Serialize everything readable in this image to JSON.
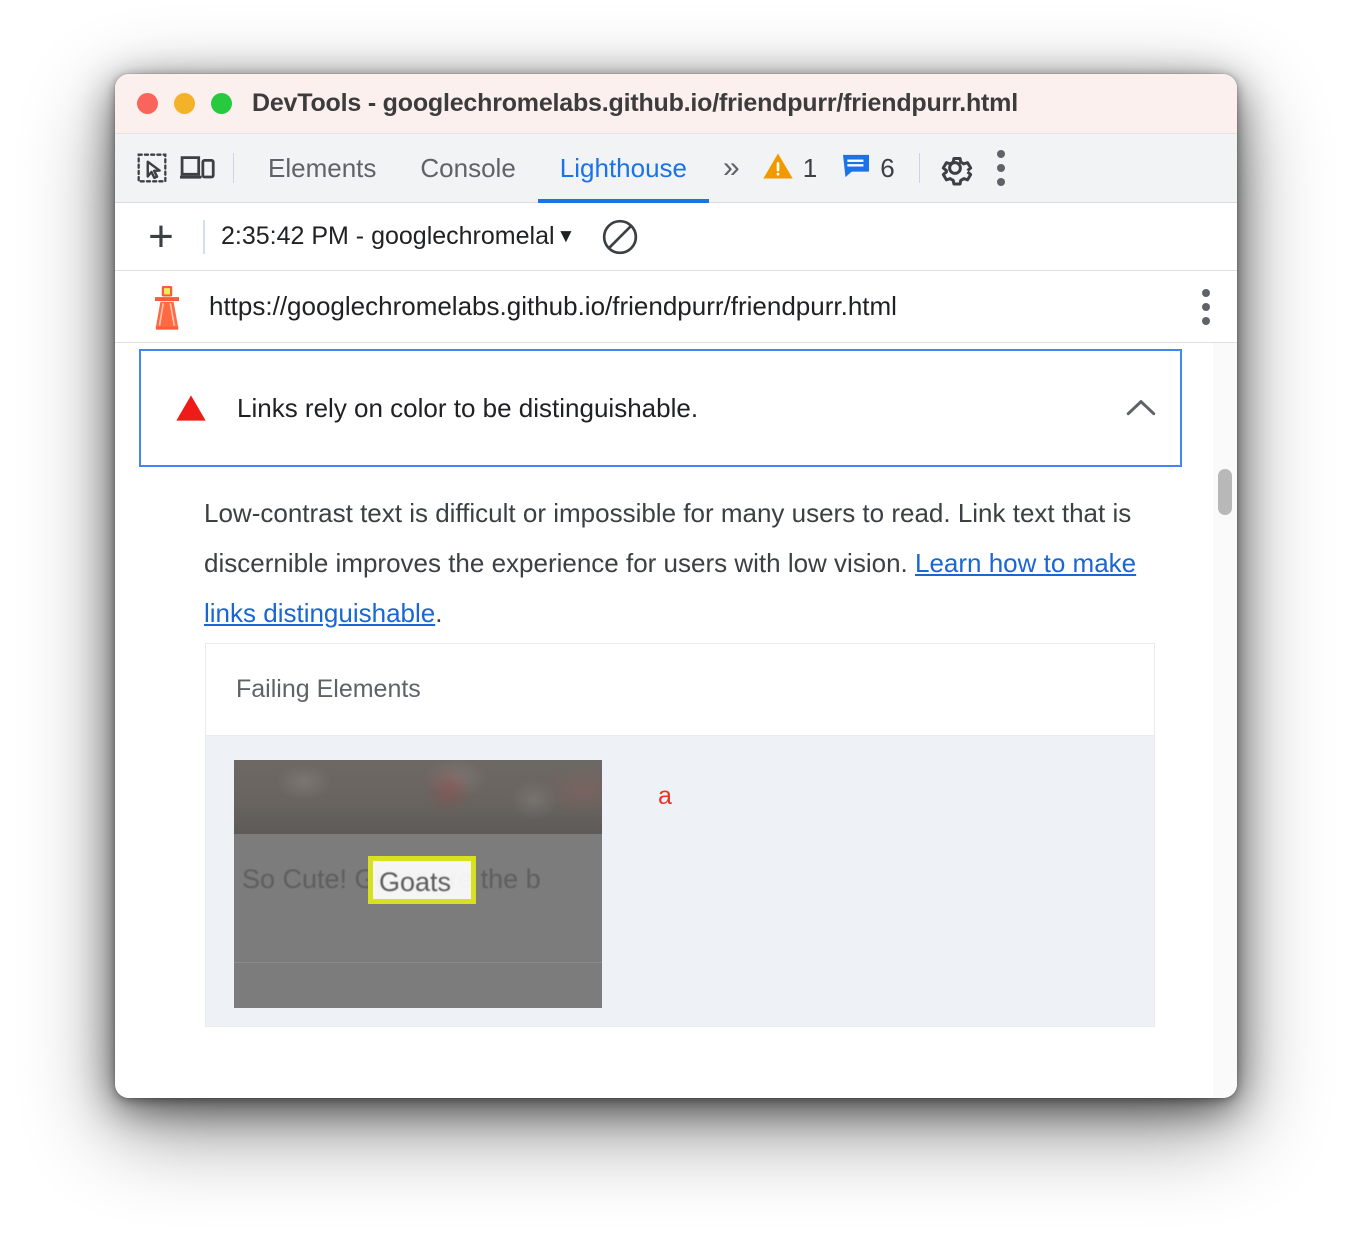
{
  "window": {
    "title": "DevTools - googlechromelabs.github.io/friendpurr/friendpurr.html",
    "traffic_lights": [
      "close",
      "minimize",
      "zoom"
    ],
    "colors": {
      "titlebar_bg": "#fbf0ed",
      "close": "#f9655b",
      "minimize": "#f3b229",
      "zoom": "#27c93f"
    }
  },
  "devtools_tabbar": {
    "inspect_icon": "inspect-element-icon",
    "device_toolbar_icon": "device-toolbar-icon",
    "tabs": [
      {
        "label": "Elements",
        "active": false
      },
      {
        "label": "Console",
        "active": false
      },
      {
        "label": "Lighthouse",
        "active": true
      }
    ],
    "more_tabs_icon": "chevron-double-right-icon",
    "warning_icon": "warning-triangle-icon",
    "warning_count": "1",
    "message_icon": "message-bubble-icon",
    "message_count": "6",
    "settings_icon": "gear-icon",
    "more_icon": "kebab-menu-icon",
    "accent_color": "#1a73e8"
  },
  "lighthouse_toolbar": {
    "add_icon": "plus-icon",
    "report_label": "2:35:42 PM - googlechromelal",
    "dropdown_icon": "caret-down-icon",
    "clear_icon": "no-entry-icon"
  },
  "urlbar": {
    "logo_icon": "lighthouse-logo-icon",
    "url": "https://googlechromelabs.github.io/friendpurr/friendpurr.html",
    "menu_icon": "kebab-menu-icon"
  },
  "audit": {
    "status_icon": "fail-triangle-icon",
    "status_color": "#ee1b18",
    "title": "Links rely on color to be distinguishable.",
    "toggle_icon": "chevron-up-icon",
    "border_color": "#4285f4",
    "description_part1": "Low-contrast text is difficult or impossible for many users to read. Link text that is discernible improves the experience for users with low vision. ",
    "description_link": "Learn how to make links distinguishable",
    "description_part2": ".",
    "link_color": "#1967d2"
  },
  "failing_elements": {
    "header": "Failing Elements",
    "rows": [
      {
        "thumbnail_caption": "So Cute! Goats are the b",
        "highlight_text": "Goats",
        "highlight_color": "#d7e11f",
        "selector": "a",
        "selector_color": "#ee3124"
      }
    ]
  },
  "scrollbar": {
    "thumb_color": "#b8b8b8",
    "track_color": "#fafafa"
  }
}
